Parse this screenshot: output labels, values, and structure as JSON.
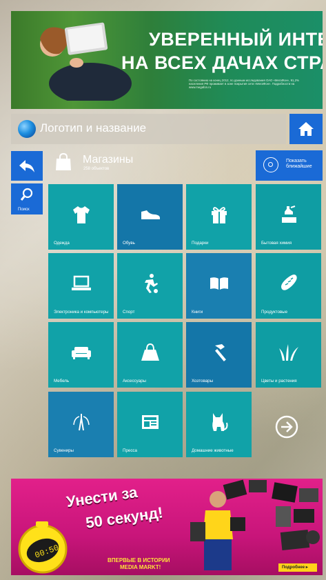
{
  "top_banner": {
    "line1": "УВЕРЕННЫЙ ИНТЕРНЕТ",
    "line2": "НА ВСЕХ ДАЧАХ СТРАНЫ",
    "fine_print": "По состоянию на конец 2012, по данным исследования ОАО «МегаФон», 91,2% населения РФ проживает в зоне покрытия сети «МегаФон». Подробности на www.megafon.ru"
  },
  "header": {
    "title": "Логотип и название",
    "home_icon": "home-icon"
  },
  "sidebar": {
    "back_icon": "back-arrow-icon",
    "search_label": "Поиск"
  },
  "category": {
    "title": "Магазины",
    "count": "258 объектов",
    "icon": "shopping-bag-icon"
  },
  "nearest_button": {
    "line1": "Показать",
    "line2": "ближайшие"
  },
  "tiles": [
    {
      "label": "Одежда",
      "icon": "tshirt-icon"
    },
    {
      "label": "Обувь",
      "icon": "shoe-icon"
    },
    {
      "label": "Подарки",
      "icon": "gift-icon"
    },
    {
      "label": "Бытовая химия",
      "icon": "cleaning-icon"
    },
    {
      "label": "Электроника и компьютеры",
      "icon": "laptop-icon"
    },
    {
      "label": "Спорт",
      "icon": "football-player-icon"
    },
    {
      "label": "Книги",
      "icon": "book-icon"
    },
    {
      "label": "Продуктовые",
      "icon": "bread-icon"
    },
    {
      "label": "Мебель",
      "icon": "sofa-icon"
    },
    {
      "label": "Аксессуары",
      "icon": "handbag-icon"
    },
    {
      "label": "Хозтовары",
      "icon": "hammer-icon"
    },
    {
      "label": "Цветы и растения",
      "icon": "grass-icon"
    },
    {
      "label": "Сувениры",
      "icon": "tower-icon"
    },
    {
      "label": "Пресса",
      "icon": "newspaper-icon"
    },
    {
      "label": "Домашние животные",
      "icon": "cat-icon"
    }
  ],
  "bottom_banner": {
    "headline1": "Унести за",
    "headline2": "50 секунд!",
    "promo1": "ВПЕРВЫЕ В ИСТОРИИ",
    "promo2": "MEDIA MARKT!",
    "more": "Подробнее ▸",
    "stopwatch": "00:50"
  },
  "colors": {
    "accent_blue": "#1a6ad6",
    "tile_teal": "#11a2a8",
    "tile_blue": "#1476a8",
    "banner_pink": "#e2208a"
  }
}
